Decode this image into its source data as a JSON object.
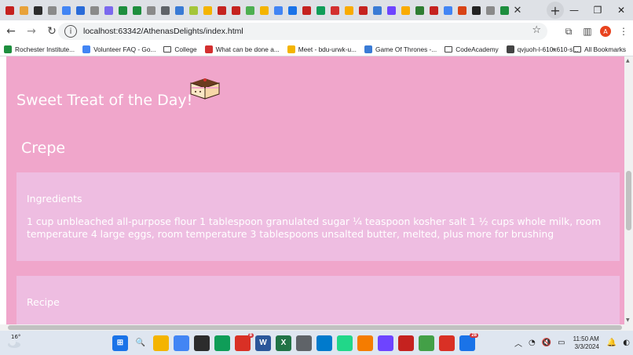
{
  "browser": {
    "tab_favicons": [
      "#c5221f",
      "#e8a23a",
      "#2c2c2c",
      "#8a8a8a",
      "#4285f4",
      "#2a6bd8",
      "#8a8a8a",
      "#7b68ee",
      "#1e8e3e",
      "#1e8e3e",
      "#8a8a8a",
      "#5f6368",
      "#3a7bd5",
      "#a4c639",
      "#f4b400",
      "#c5221f",
      "#c5221f",
      "#4caf50",
      "#f4b400",
      "#4285f4",
      "#1a73e8",
      "#c5221f",
      "#0f9d58",
      "#d32f2f",
      "#f9ab00",
      "#c5221f",
      "#3a7bd5",
      "#6e44ff",
      "#f9ab00",
      "#2e7d32",
      "#c5221f",
      "#4285f4",
      "#d84315",
      "#222222",
      "#8a8a8a",
      "#1e8e3e"
    ],
    "tab_close": "✕",
    "new_tab": "+",
    "window": {
      "minimize": "—",
      "maximize": "❐",
      "close": "✕"
    },
    "nav": {
      "back": "←",
      "forward": "→",
      "reload": "↻"
    },
    "url": "localhost:63342/AthenasDelights/index.html",
    "avatar_letter": "A",
    "bookmarks": [
      {
        "label": "Rochester Institute...",
        "icon": "rit-icon",
        "color": "#1e8e3e"
      },
      {
        "label": "Volunteer FAQ - Go...",
        "icon": "docs-icon",
        "color": "#4285f4"
      },
      {
        "label": "College",
        "icon": "folder-icon",
        "color": ""
      },
      {
        "label": "What can be done a...",
        "icon": "chat-icon",
        "color": "#d32f2f"
      },
      {
        "label": "Meet - bdu-urwk-u...",
        "icon": "meet-icon",
        "color": "#f4b400"
      },
      {
        "label": "Game Of Thrones -...",
        "icon": "video-icon",
        "color": "#3a7bd5"
      },
      {
        "label": "CodeAcademy",
        "icon": "folder-icon",
        "color": ""
      },
      {
        "label": "qvjuoh-l-610x610-s...",
        "icon": "globe-icon",
        "color": "#444444"
      }
    ],
    "bookmarks_more": "»",
    "all_bookmarks": "All Bookmarks"
  },
  "page": {
    "treat_title": "Sweet Treat of the Day!",
    "recipe_name": "Crepe",
    "ingredients_heading": "Ingredients",
    "ingredients_text": "1 cup unbleached all-purpose flour 1 tablespoon granulated sugar ¼ teaspoon kosher salt 1 ½ cups whole milk, room temperature 4 large eggs, room temperature 3 tablespoons unsalted butter, melted, plus more for brushing",
    "recipe_heading": "Recipe",
    "colors": {
      "background": "#f0a6cb",
      "card": "#eebde1",
      "text": "#ffffff"
    }
  },
  "taskbar": {
    "temperature": "16°",
    "apps": [
      {
        "name": "start-button",
        "color": "#1a73e8",
        "glyph": "⊞"
      },
      {
        "name": "search-button",
        "color": "#dfe6f0",
        "glyph": "🔍"
      },
      {
        "name": "file-explorer",
        "color": "#f4b400",
        "glyph": ""
      },
      {
        "name": "store",
        "color": "#4285f4",
        "glyph": ""
      },
      {
        "name": "terminal",
        "color": "#2c2c2c",
        "glyph": ""
      },
      {
        "name": "edge",
        "color": "#0f9d58",
        "glyph": ""
      },
      {
        "name": "chrome",
        "color": "#d93025",
        "glyph": ""
      },
      {
        "name": "word",
        "color": "#2b579a",
        "glyph": "W"
      },
      {
        "name": "excel",
        "color": "#217346",
        "glyph": "X"
      },
      {
        "name": "settings",
        "color": "#5f6368",
        "glyph": ""
      },
      {
        "name": "vscode",
        "color": "#007acc",
        "glyph": ""
      },
      {
        "name": "pycharm",
        "color": "#21d789",
        "glyph": ""
      },
      {
        "name": "app-orange",
        "color": "#f57c00",
        "glyph": ""
      },
      {
        "name": "github",
        "color": "#6e44ff",
        "glyph": ""
      },
      {
        "name": "snip",
        "color": "#c5221f",
        "glyph": ""
      },
      {
        "name": "notepad",
        "color": "#43a047",
        "glyph": ""
      },
      {
        "name": "chrome-2",
        "color": "#d93025",
        "glyph": ""
      },
      {
        "name": "messages",
        "color": "#1a73e8",
        "glyph": ""
      }
    ],
    "badges": {
      "chrome": "8",
      "messages": "28"
    },
    "time": "11:50 AM",
    "date": "3/3/2024"
  }
}
